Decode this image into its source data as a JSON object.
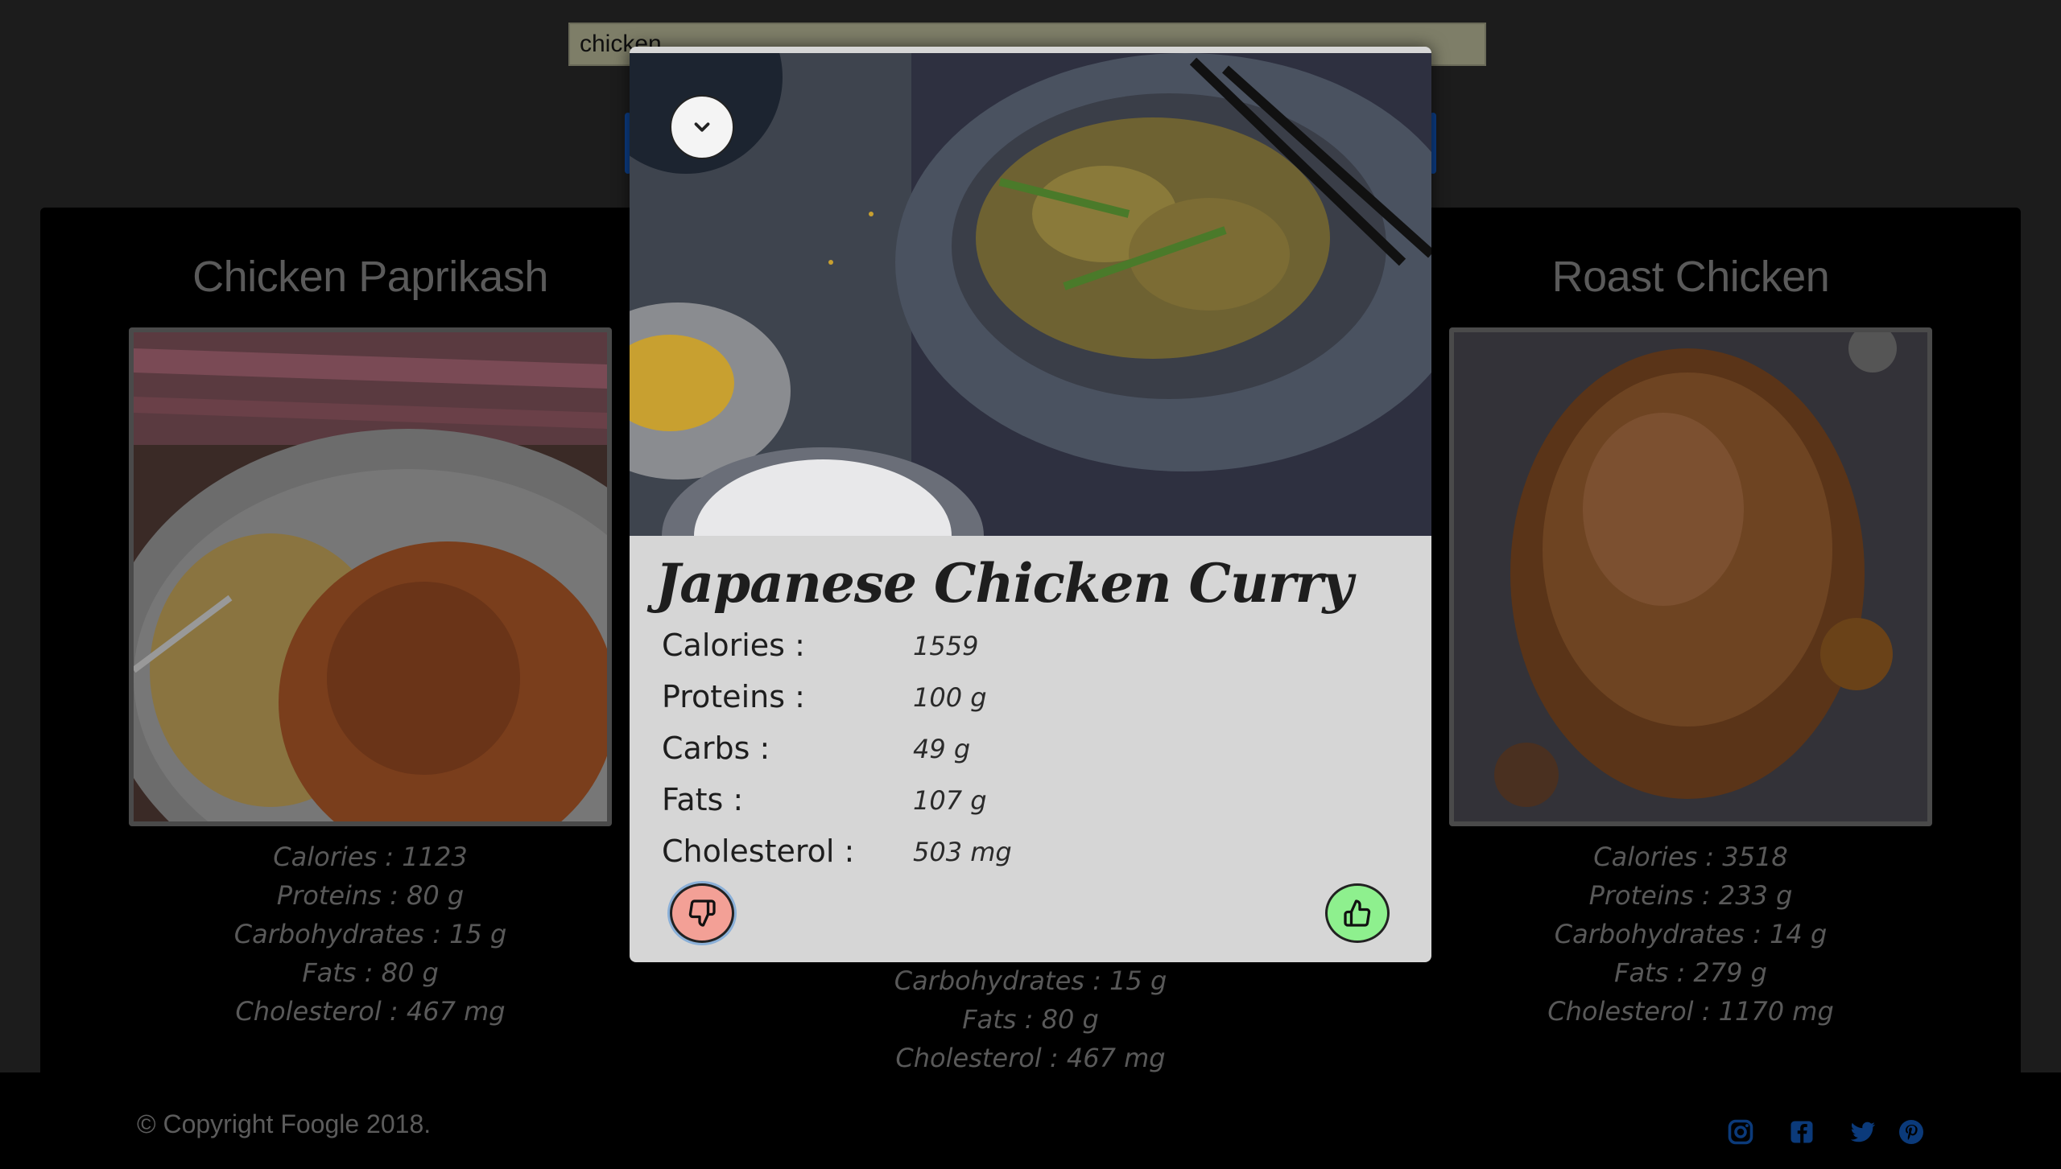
{
  "search": {
    "value": "chicken"
  },
  "cards": [
    {
      "title": "Chicken Paprikash",
      "stats": [
        "Calories : 1123",
        "Proteins : 80 g",
        "Carbohydrates : 15 g",
        "Fats : 80 g",
        "Cholesterol : 467 mg"
      ]
    },
    {
      "title": "Roast Chicken",
      "stats": [
        "Calories : 3518",
        "Proteins : 233 g",
        "Carbohydrates : 14 g",
        "Fats : 279 g",
        "Cholesterol : 1170 mg"
      ]
    }
  ],
  "center_card": {
    "stats": [
      "Carbohydrates : 15 g",
      "Fats : 80 g",
      "Cholesterol : 467 mg"
    ]
  },
  "modal": {
    "title": "Japanese Chicken Curry",
    "nutrients": [
      {
        "label": "Calories :",
        "value": "1559"
      },
      {
        "label": "Proteins :",
        "value": "100 g"
      },
      {
        "label": "Carbs :",
        "value": "49 g"
      },
      {
        "label": "Fats :",
        "value": "107 g"
      },
      {
        "label": "Cholesterol :",
        "value": "503 mg"
      }
    ],
    "buttons": {
      "collapse_icon": "chevron-down-icon",
      "dislike_icon": "thumbs-down-icon",
      "like_icon": "thumbs-up-icon"
    },
    "colors": {
      "dislike": "#f3a096",
      "like": "#8ef08e"
    }
  },
  "footer": {
    "copyright": "© Copyright Foogle 2018.",
    "social_icons": [
      "instagram-icon",
      "facebook-icon",
      "twitter-icon",
      "pinterest-icon"
    ],
    "social_color": "#0b3a7a"
  }
}
